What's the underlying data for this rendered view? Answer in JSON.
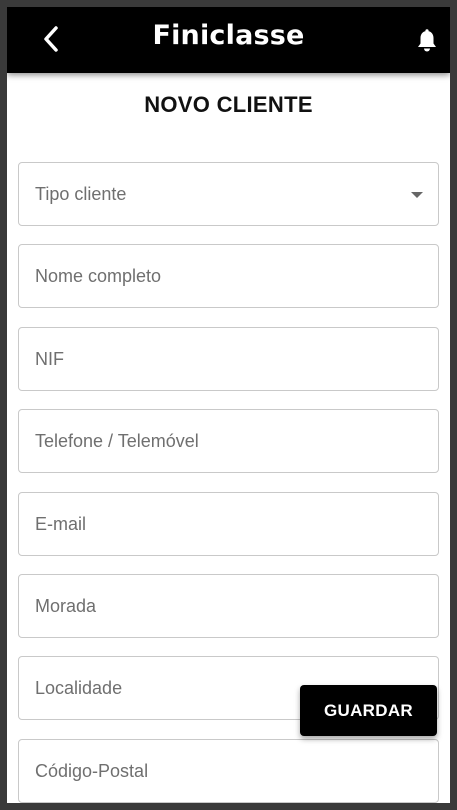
{
  "header": {
    "brand": "Finiclasse",
    "back_icon": "chevron-left-icon",
    "notification_icon": "bell-icon"
  },
  "page": {
    "title": "NOVO CLIENTE"
  },
  "form": {
    "client_type": {
      "placeholder": "Tipo cliente"
    },
    "full_name": {
      "placeholder": "Nome completo"
    },
    "nif": {
      "placeholder": "NIF"
    },
    "phone": {
      "placeholder": "Telefone / Telemóvel"
    },
    "email": {
      "placeholder": "E-mail"
    },
    "address": {
      "placeholder": "Morada"
    },
    "locality": {
      "placeholder": "Localidade"
    },
    "postal_code": {
      "placeholder": "Código-Postal"
    }
  },
  "actions": {
    "save_label": "GUARDAR"
  },
  "colors": {
    "appbar": "#000000",
    "background": "#ffffff",
    "field_border": "#c9c9c9",
    "placeholder": "#6f6f6f"
  }
}
